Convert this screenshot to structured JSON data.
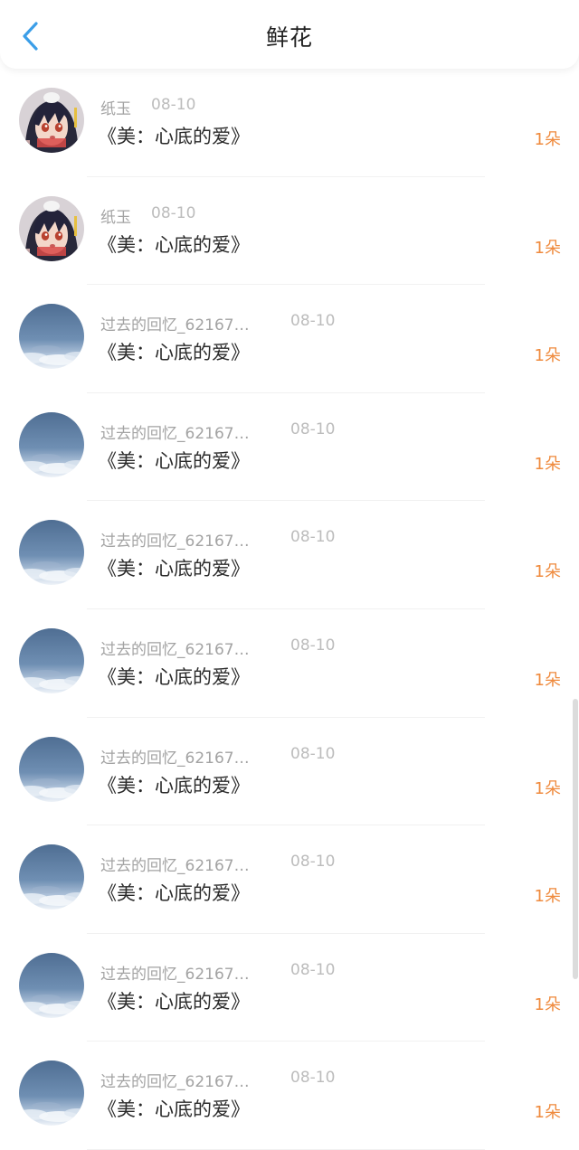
{
  "header": {
    "title": "鲜花",
    "back_icon": "chevron-left-icon",
    "accent_color": "#3b9ee8"
  },
  "gift_color": "#ef8a3d",
  "flowers": [
    {
      "user": "纸玉",
      "date": "08-10",
      "gift": "《美：心底的爱》",
      "amount": "1朵",
      "avatar": "anime-avatar"
    },
    {
      "user": "纸玉",
      "date": "08-10",
      "gift": "《美：心底的爱》",
      "amount": "1朵",
      "avatar": "anime-avatar"
    },
    {
      "user": "过去的回忆_62167…",
      "date": "08-10",
      "gift": "《美：心底的爱》",
      "amount": "1朵",
      "avatar": "sky-avatar"
    },
    {
      "user": "过去的回忆_62167…",
      "date": "08-10",
      "gift": "《美：心底的爱》",
      "amount": "1朵",
      "avatar": "sky-avatar"
    },
    {
      "user": "过去的回忆_62167…",
      "date": "08-10",
      "gift": "《美：心底的爱》",
      "amount": "1朵",
      "avatar": "sky-avatar"
    },
    {
      "user": "过去的回忆_62167…",
      "date": "08-10",
      "gift": "《美：心底的爱》",
      "amount": "1朵",
      "avatar": "sky-avatar"
    },
    {
      "user": "过去的回忆_62167…",
      "date": "08-10",
      "gift": "《美：心底的爱》",
      "amount": "1朵",
      "avatar": "sky-avatar"
    },
    {
      "user": "过去的回忆_62167…",
      "date": "08-10",
      "gift": "《美：心底的爱》",
      "amount": "1朵",
      "avatar": "sky-avatar"
    },
    {
      "user": "过去的回忆_62167…",
      "date": "08-10",
      "gift": "《美：心底的爱》",
      "amount": "1朵",
      "avatar": "sky-avatar"
    },
    {
      "user": "过去的回忆_62167…",
      "date": "08-10",
      "gift": "《美：心底的爱》",
      "amount": "1朵",
      "avatar": "sky-avatar"
    }
  ]
}
